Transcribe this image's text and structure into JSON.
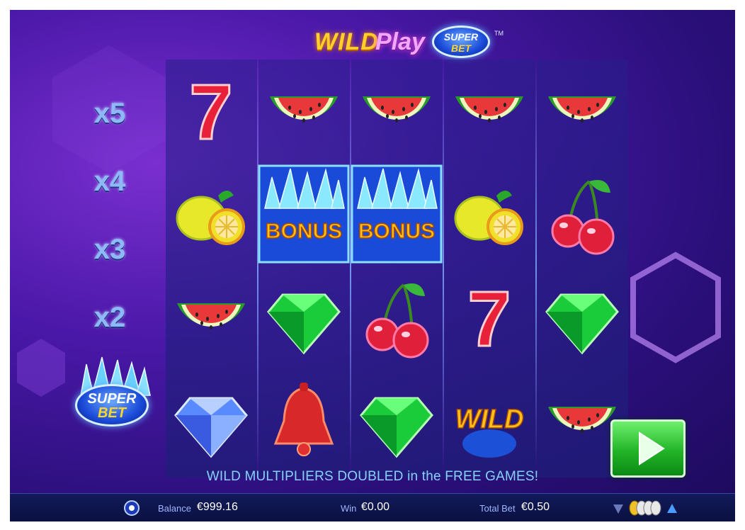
{
  "logo": {
    "wild": "WILD",
    "play": "Play",
    "super": "SUPER",
    "bet": "BET",
    "tm": "TM"
  },
  "multipliers": [
    "x5",
    "x4",
    "x3",
    "x2"
  ],
  "super_bet_button": {
    "super": "SUPER",
    "bet": "BET"
  },
  "reels": [
    [
      "seven",
      "lemon",
      "watermelon",
      "blue-diamond"
    ],
    [
      "watermelon",
      "bonus",
      "green-emerald",
      "bell"
    ],
    [
      "watermelon",
      "bonus",
      "cherry",
      "green-emerald"
    ],
    [
      "watermelon",
      "lemon",
      "seven",
      "wild"
    ],
    [
      "watermelon",
      "cherry",
      "green-emerald",
      "watermelon"
    ]
  ],
  "symbol_text": {
    "bonus": "BONUS",
    "wild": "WILD",
    "seven": "7"
  },
  "message": "WILD MULTIPLIERS DOUBLED in the FREE GAMES!",
  "bottom_bar": {
    "balance_label": "Balance",
    "balance_value": "€999.16",
    "win_label": "Win",
    "win_value": "€0.00",
    "total_bet_label": "Total Bet",
    "total_bet_value": "€0.50"
  },
  "icons": {
    "settings": "gear-icon",
    "spin": "play-arrow-icon",
    "bet_down": "triangle-down-icon",
    "bet_up": "triangle-up-icon",
    "chips": "coin-stack-icon"
  },
  "colors": {
    "background": "#3a14a0",
    "spin_button": "#22b428",
    "message": "#8ad0ff",
    "gold_text": "#ffcf2a"
  }
}
